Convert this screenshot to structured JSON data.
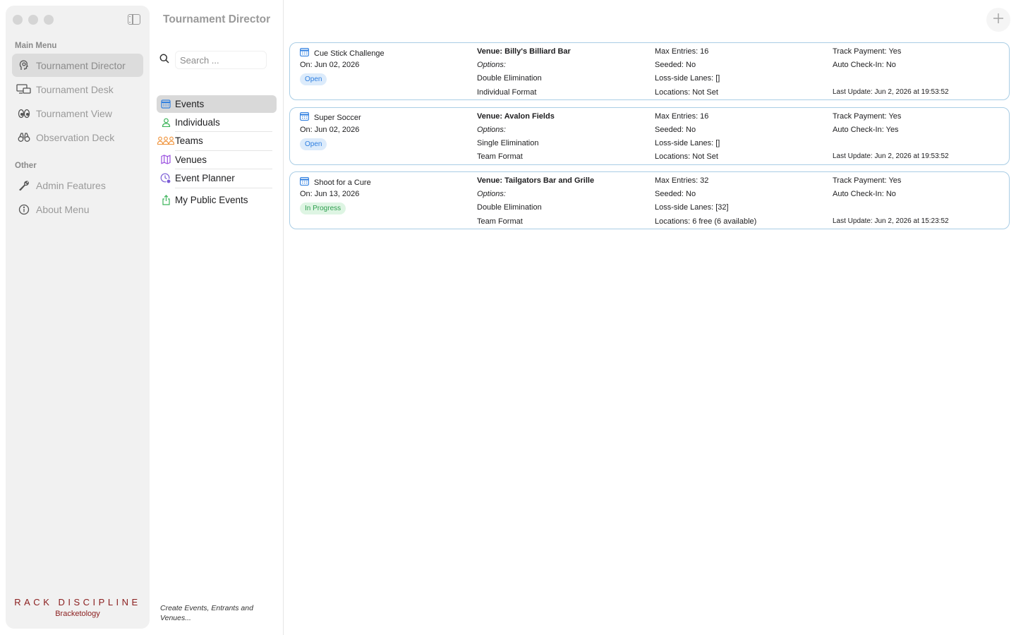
{
  "sidebar": {
    "section_main": "Main Menu",
    "section_other": "Other",
    "items": [
      {
        "label": "Tournament Director",
        "icon": "head-icon"
      },
      {
        "label": "Tournament Desk",
        "icon": "desk-icon"
      },
      {
        "label": "Tournament View",
        "icon": "eyes-icon"
      },
      {
        "label": "Observation Deck",
        "icon": "binoculars-icon"
      }
    ],
    "other_items": [
      {
        "label": "Admin Features",
        "icon": "wrench-icon"
      },
      {
        "label": "About Menu",
        "icon": "info-icon"
      }
    ],
    "brand": "RACK DISCIPLINE",
    "brand_sub": "Bracketology"
  },
  "middle": {
    "title": "Tournament Director",
    "search_placeholder": "Search ...",
    "categories": [
      {
        "label": "Events",
        "icon": "calendar-icon",
        "color": "#2f7fe0"
      },
      {
        "label": "Individuals",
        "icon": "person-icon",
        "color": "#3cb45a"
      },
      {
        "label": "Teams",
        "icon": "people-icon",
        "color": "#f0933a"
      },
      {
        "label": "Venues",
        "icon": "map-icon",
        "color": "#9b51e0"
      },
      {
        "label": "Event Planner",
        "icon": "planner-icon",
        "color": "#7b5cd6"
      },
      {
        "label": "My Public Events",
        "icon": "share-icon",
        "color": "#3cb45a"
      }
    ],
    "footer": "Create Events, Entrants and Venues..."
  },
  "events": [
    {
      "name": "Cue Stick Challenge",
      "date": "On: Jun 02, 2026",
      "status": "Open",
      "venue": "Venue: Billy's Billiard Bar",
      "options": "Options:",
      "elimination": "Double Elimination",
      "format": "Individual Format",
      "max_entries": "Max Entries: 16",
      "seeded": "Seeded: No",
      "loss_lanes": "Loss-side Lanes: []",
      "locations": "Locations: Not Set",
      "track_payment": "Track Payment: Yes",
      "auto_checkin": "Auto Check-In: No",
      "last_update": "Last Update: Jun 2, 2026 at 19:53:52"
    },
    {
      "name": "Super Soccer",
      "date": "On: Jun 02, 2026",
      "status": "Open",
      "venue": "Venue: Avalon Fields",
      "options": "Options:",
      "elimination": "Single Elimination",
      "format": "Team Format",
      "max_entries": "Max Entries: 16",
      "seeded": "Seeded: No",
      "loss_lanes": "Loss-side Lanes: []",
      "locations": "Locations: Not Set",
      "track_payment": "Track Payment: Yes",
      "auto_checkin": "Auto Check-In: Yes",
      "last_update": "Last Update: Jun 2, 2026 at 19:53:52"
    },
    {
      "name": "Shoot for a Cure",
      "date": "On: Jun 13, 2026",
      "status": "In Progress",
      "venue": "Venue: Tailgators Bar and Grille",
      "options": "Options:",
      "elimination": "Double Elimination",
      "format": "Team Format",
      "max_entries": "Max Entries: 32",
      "seeded": "Seeded: No",
      "loss_lanes": "Loss-side Lanes: [32]",
      "locations": "Locations: 6 free (6 available)",
      "track_payment": "Track Payment: Yes",
      "auto_checkin": "Auto Check-In: No",
      "last_update": "Last Update: Jun 2, 2026 at 15:23:52"
    }
  ],
  "colors": {
    "accent": "#2f7fe0",
    "open_badge_bg": "#dcebfb",
    "open_badge_text": "#2f7fe0",
    "progress_badge_bg": "#def5e3",
    "progress_badge_text": "#2e9e4f",
    "card_border": "#a9cde5",
    "brand": "#8a1d1d"
  }
}
